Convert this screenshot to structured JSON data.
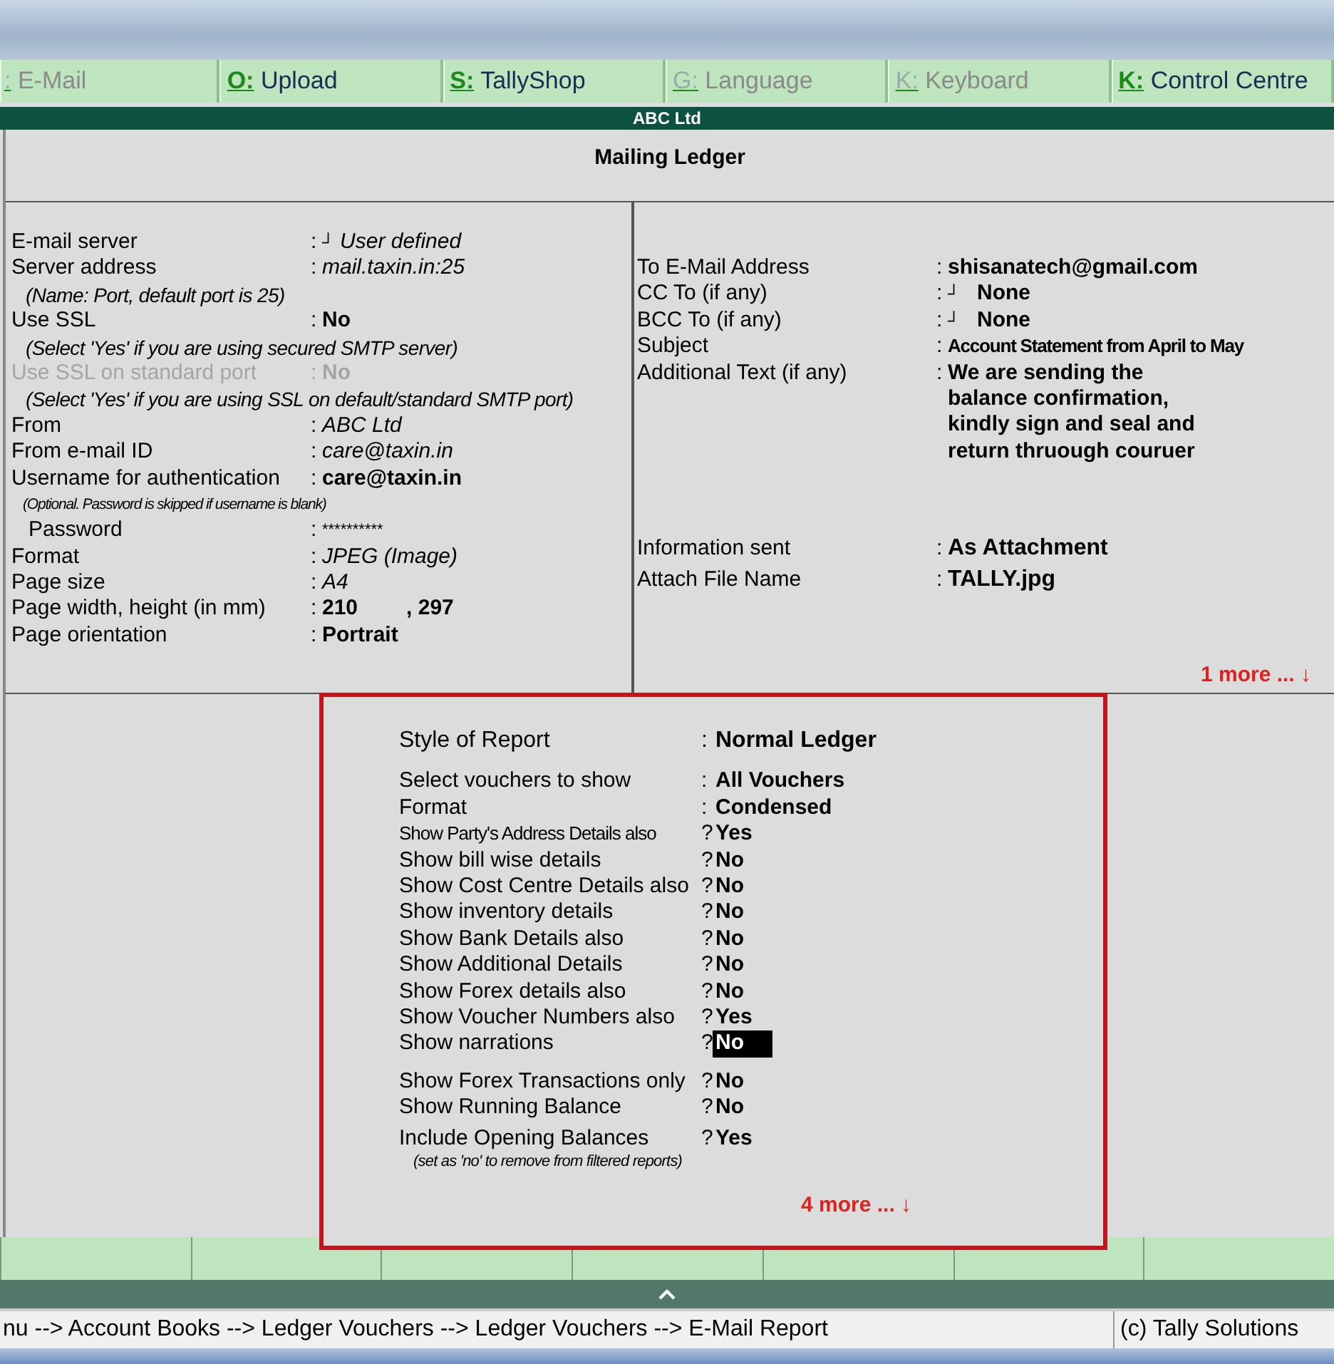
{
  "toolbar": [
    {
      "key": ":",
      "label": "E-Mail",
      "disabled": true
    },
    {
      "key": "O:",
      "label": "Upload",
      "disabled": false
    },
    {
      "key": "S:",
      "label": "TallyShop",
      "disabled": false
    },
    {
      "key": "G:",
      "label": "Language",
      "disabled": true
    },
    {
      "key": "K:",
      "label": "Keyboard",
      "disabled": true
    },
    {
      "key": "K:",
      "label": "Control Centre",
      "disabled": false
    }
  ],
  "company": "ABC Ltd",
  "report_title": "Mailing Ledger",
  "server_settings": [
    {
      "kind": "default",
      "label": "E-mail server",
      "separator": ":",
      "marker": "┘",
      "value": "User defined",
      "disabled": false
    },
    {
      "kind": "default",
      "label": "Server address",
      "separator": ":",
      "value": "mail.taxin.in:25",
      "disabled": false
    },
    {
      "kind": "note",
      "text": "(Name: Port, default port is 25)"
    },
    {
      "kind": "entered",
      "label": "Use SSL",
      "separator": ":",
      "value": "No",
      "disabled": false
    },
    {
      "kind": "note",
      "text": "(Select 'Yes' if you are using secured SMTP server)"
    },
    {
      "kind": "entered",
      "label": "Use SSL on standard port",
      "separator": ":",
      "value": "No",
      "disabled": true
    },
    {
      "kind": "note",
      "text": "(Select 'Yes' if you are using SSL on default/standard SMTP port)"
    },
    {
      "kind": "default",
      "label": "From",
      "separator": ":",
      "value": "ABC Ltd",
      "disabled": false
    },
    {
      "kind": "default",
      "label": "From e-mail ID",
      "separator": ":",
      "value": "care@taxin.in",
      "disabled": false
    },
    {
      "kind": "entered",
      "label": "Username for authentication",
      "separator": ":",
      "value": "care@taxin.in",
      "disabled": false
    },
    {
      "kind": "small_note",
      "text": "(Optional. Password is skipped if username is blank)"
    },
    {
      "kind": "masked",
      "label": "Password",
      "separator": ":",
      "value": "**********",
      "disabled": false
    },
    {
      "kind": "default",
      "label": "Format",
      "separator": ":",
      "value": "JPEG (Image)",
      "disabled": false
    },
    {
      "kind": "default",
      "label": "Page size",
      "separator": ":",
      "value": "A4",
      "disabled": false
    },
    {
      "kind": "entered",
      "label": "Page width, height (in mm)",
      "separator": ":",
      "value": "210",
      "value_2": ", 297",
      "disabled": false
    },
    {
      "kind": "entered",
      "label": "Page orientation",
      "separator": ":",
      "value": "Portrait",
      "disabled": false
    }
  ],
  "recipients": [
    {
      "kind": "entered",
      "label": "To E-Mail Address",
      "separator": ":",
      "value_lines": [
        "shisanatech@gmail.com"
      ]
    },
    {
      "kind": "entered",
      "label": "CC To (if any)",
      "separator": ":",
      "marker": "┘",
      "value_lines": [
        "None"
      ]
    },
    {
      "kind": "entered",
      "label": "BCC To (if any)",
      "separator": ":",
      "marker": "┘",
      "value_lines": [
        "None"
      ]
    },
    {
      "kind": "condensed",
      "label": "Subject",
      "separator": ":",
      "value_lines": [
        "Account Statement from April to May"
      ]
    },
    {
      "kind": "entered",
      "label": "Additional Text (if any)",
      "separator": ":",
      "value_lines": [
        "We are sending the",
        "balance confirmation,",
        "kindly sign and seal and",
        "return thruough couruer"
      ]
    }
  ],
  "attachment": [
    {
      "label": "Information sent",
      "separator": ":",
      "value": "As Attachment"
    },
    {
      "label": "Attach File Name",
      "separator": ":",
      "value": "TALLY.jpg"
    }
  ],
  "more_link": "1 more ... ↓",
  "options_popup": {
    "sections": [
      [
        {
          "kind": "field",
          "label": "Style of Report",
          "separator": ":",
          "value": "Normal Ledger",
          "focused": false
        }
      ],
      [
        {
          "kind": "field",
          "label": "Select vouchers to show",
          "separator": ":",
          "value": "All Vouchers",
          "focused": false
        },
        {
          "kind": "field",
          "label": "Format",
          "separator": ":",
          "value": "Condensed",
          "focused": false
        },
        {
          "kind": "condensed",
          "label": "Show Party's Address Details also",
          "separator": "?",
          "value": "Yes",
          "focused": false
        },
        {
          "kind": "field",
          "label": "Show bill wise details",
          "separator": "?",
          "value": "No",
          "focused": false
        },
        {
          "kind": "field",
          "label": "Show Cost Centre Details also",
          "separator": "?",
          "value": "No",
          "focused": false
        },
        {
          "kind": "field",
          "label": "Show inventory details",
          "separator": "?",
          "value": "No",
          "focused": false
        },
        {
          "kind": "field",
          "label": "Show Bank Details also",
          "separator": "?",
          "value": "No",
          "focused": false
        },
        {
          "kind": "field",
          "label": "Show Additional Details",
          "separator": "?",
          "value": "No",
          "focused": false
        },
        {
          "kind": "field",
          "label": "Show Forex details also",
          "separator": "?",
          "value": "No",
          "focused": false
        },
        {
          "kind": "field",
          "label": "Show Voucher Numbers also",
          "separator": "?",
          "value": "Yes",
          "focused": false
        },
        {
          "kind": "field",
          "label": "Show narrations",
          "separator": "?",
          "value": "No",
          "focused": true
        }
      ],
      [
        {
          "kind": "field",
          "label": "Show Forex Transactions only",
          "separator": "?",
          "value": "No",
          "focused": false
        },
        {
          "kind": "field",
          "label": "Show Running Balance",
          "separator": "?",
          "value": "No",
          "focused": false
        }
      ],
      [
        {
          "kind": "field",
          "label": "Include Opening Balances",
          "separator": "?",
          "value": "Yes",
          "focused": false
        },
        {
          "kind": "note",
          "text": "(set as 'no' to remove from filtered reports)"
        }
      ]
    ],
    "more_link": "4 more ... ↓"
  },
  "status_bar": {
    "path": "nu --> Account Books --> Ledger Vouchers --> Ledger Vouchers --> E-Mail Report",
    "copyright": "(c) Tally Solutions"
  }
}
